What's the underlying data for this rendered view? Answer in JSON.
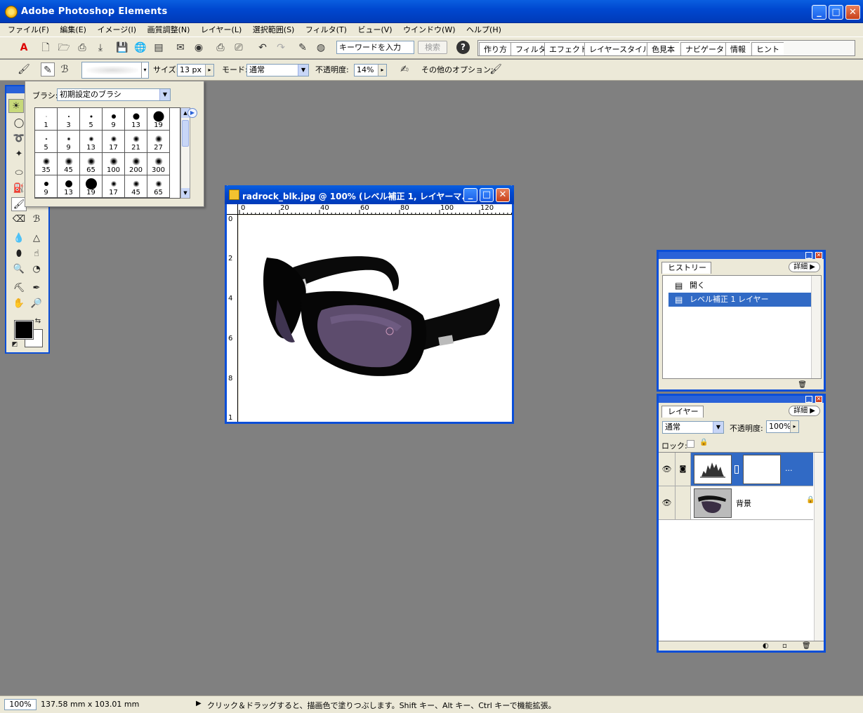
{
  "app": {
    "title": "Adobe Photoshop Elements"
  },
  "window_controls": {
    "minimize": "_",
    "maximize": "□",
    "close": "✕"
  },
  "menu": [
    "ファイル(F)",
    "編集(E)",
    "イメージ(I)",
    "画質調整(N)",
    "レイヤー(L)",
    "選択範囲(S)",
    "フィルタ(T)",
    "ビュー(V)",
    "ウインドウ(W)",
    "ヘルプ(H)"
  ],
  "shortcuts": {
    "search_placeholder": "キーワードを入力",
    "search_button": "検索",
    "help": "?",
    "palette_tabs": [
      "作り方",
      "フィルタ",
      "エフェクト",
      "レイヤースタイル",
      "色見本",
      "ナビゲータ",
      "情報",
      "ヒント"
    ]
  },
  "options": {
    "size_label": "サイズ:",
    "size_value": "13 px",
    "mode_label": "モード:",
    "mode_value": "通常",
    "opacity_label": "不透明度:",
    "opacity_value": "14%",
    "other_label": "その他のオプション:"
  },
  "brush_popup": {
    "label": "ブラシ:",
    "set_value": "初期設定のブラシ",
    "brushes": [
      {
        "size": "1",
        "dot": 1,
        "soft": false
      },
      {
        "size": "3",
        "dot": 2,
        "soft": false
      },
      {
        "size": "5",
        "dot": 3,
        "soft": false
      },
      {
        "size": "9",
        "dot": 6,
        "soft": false
      },
      {
        "size": "13",
        "dot": 9,
        "soft": false
      },
      {
        "size": "19",
        "dot": 15,
        "soft": false
      },
      {
        "size": "5",
        "dot": 3,
        "soft": true
      },
      {
        "size": "9",
        "dot": 5,
        "soft": true
      },
      {
        "size": "13",
        "dot": 7,
        "soft": true
      },
      {
        "size": "17",
        "dot": 8,
        "soft": true
      },
      {
        "size": "21",
        "dot": 9,
        "soft": true
      },
      {
        "size": "27",
        "dot": 10,
        "soft": true
      },
      {
        "size": "35",
        "dot": 10,
        "soft": true
      },
      {
        "size": "45",
        "dot": 11,
        "soft": true
      },
      {
        "size": "65",
        "dot": 11,
        "soft": true
      },
      {
        "size": "100",
        "dot": 11,
        "soft": true
      },
      {
        "size": "200",
        "dot": 11,
        "soft": true
      },
      {
        "size": "300",
        "dot": 11,
        "soft": true
      },
      {
        "size": "9",
        "dot": 6,
        "soft": false
      },
      {
        "size": "13",
        "dot": 10,
        "soft": false
      },
      {
        "size": "19",
        "dot": 16,
        "soft": false
      },
      {
        "size": "17",
        "dot": 8,
        "soft": true
      },
      {
        "size": "45",
        "dot": 9,
        "soft": true
      },
      {
        "size": "65",
        "dot": 9,
        "soft": true
      }
    ]
  },
  "document": {
    "title": "radrock_blk.jpg @ 100% (レベル補正 1, レイヤーマ...",
    "ruler_top": [
      "0",
      "20",
      "40",
      "60",
      "80",
      "100",
      "120"
    ],
    "ruler_left": [
      "0",
      "2",
      "4",
      "6",
      "8",
      "1"
    ]
  },
  "history": {
    "tab": "ヒストリー",
    "more": "詳細 ▶",
    "items": [
      {
        "label": "開く",
        "selected": false
      },
      {
        "label": "レベル補正 1 レイヤー",
        "selected": true
      }
    ]
  },
  "layers": {
    "tab": "レイヤー",
    "more": "詳細 ▶",
    "mode_value": "通常",
    "opacity_label": "不透明度:",
    "opacity_value": "100%",
    "lock_label": "ロック:",
    "items": [
      {
        "name": "...",
        "selected": true
      },
      {
        "name": "背景",
        "selected": false
      }
    ]
  },
  "status": {
    "zoom": "100%",
    "doc_size": "137.58 mm x 103.01 mm",
    "message": "クリック＆ドラッグすると、描画色で塗りつぶします。Shift キー、Alt キー、Ctrl キーで機能拡張。"
  },
  "colors": {
    "titlebar": "#0048d0",
    "selection": "#316ac5",
    "workspace": "#808080",
    "chrome": "#ece9d8"
  }
}
